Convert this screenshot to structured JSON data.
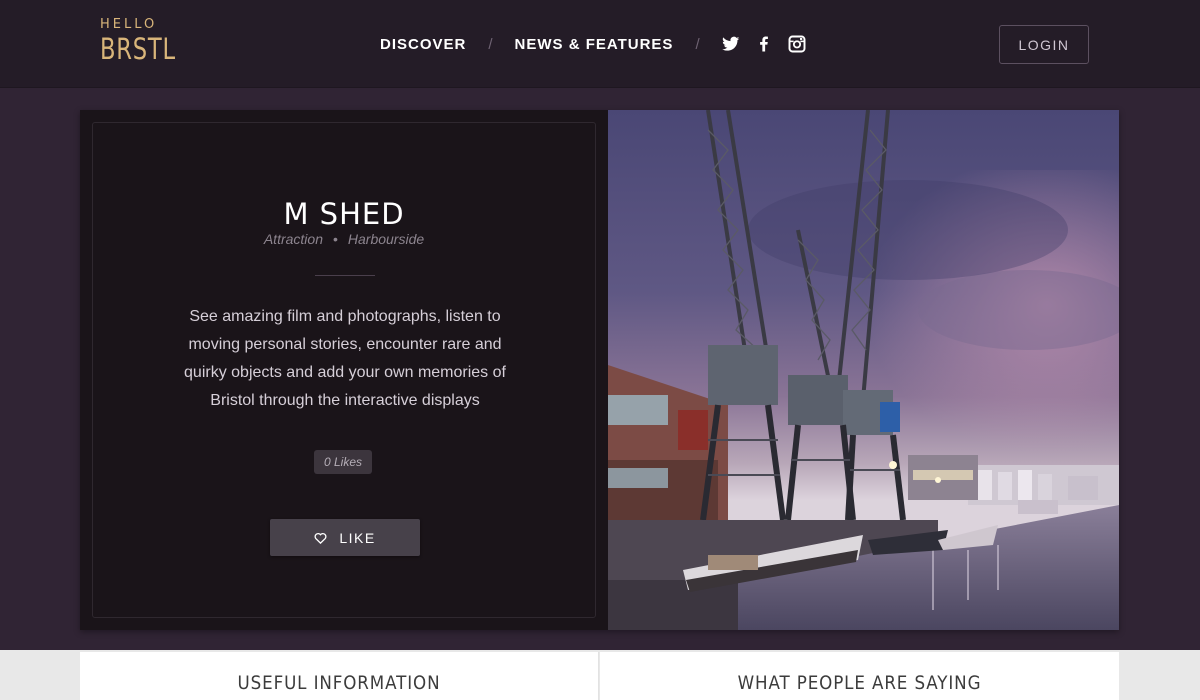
{
  "header": {
    "logo": {
      "small": "HELLO",
      "big": "BRSTL"
    },
    "nav": [
      {
        "label": "DISCOVER"
      },
      {
        "label": "NEWS & FEATURES"
      }
    ],
    "social_icons": [
      "twitter-icon",
      "facebook-icon",
      "instagram-icon"
    ],
    "login_label": "LOGIN"
  },
  "place": {
    "title": "M SHED",
    "category": "Attraction",
    "separator": "•",
    "area": "Harbourside",
    "description": "See amazing film and photographs, listen to moving personal stories, encounter rare and quirky objects and add your own memories of Bristol through the interactive displays",
    "likes": "0 Likes",
    "like_button": "LIKE",
    "photo_subject": "harbourside cranes at dusk"
  },
  "sections": {
    "left_heading": "USEFUL INFORMATION",
    "right_heading": "WHAT PEOPLE ARE SAYING"
  },
  "colors": {
    "page_bg": "#302434",
    "header_bg": "#241c27",
    "card_bg": "#1a1419",
    "logo_gold": "#d9b57a"
  }
}
